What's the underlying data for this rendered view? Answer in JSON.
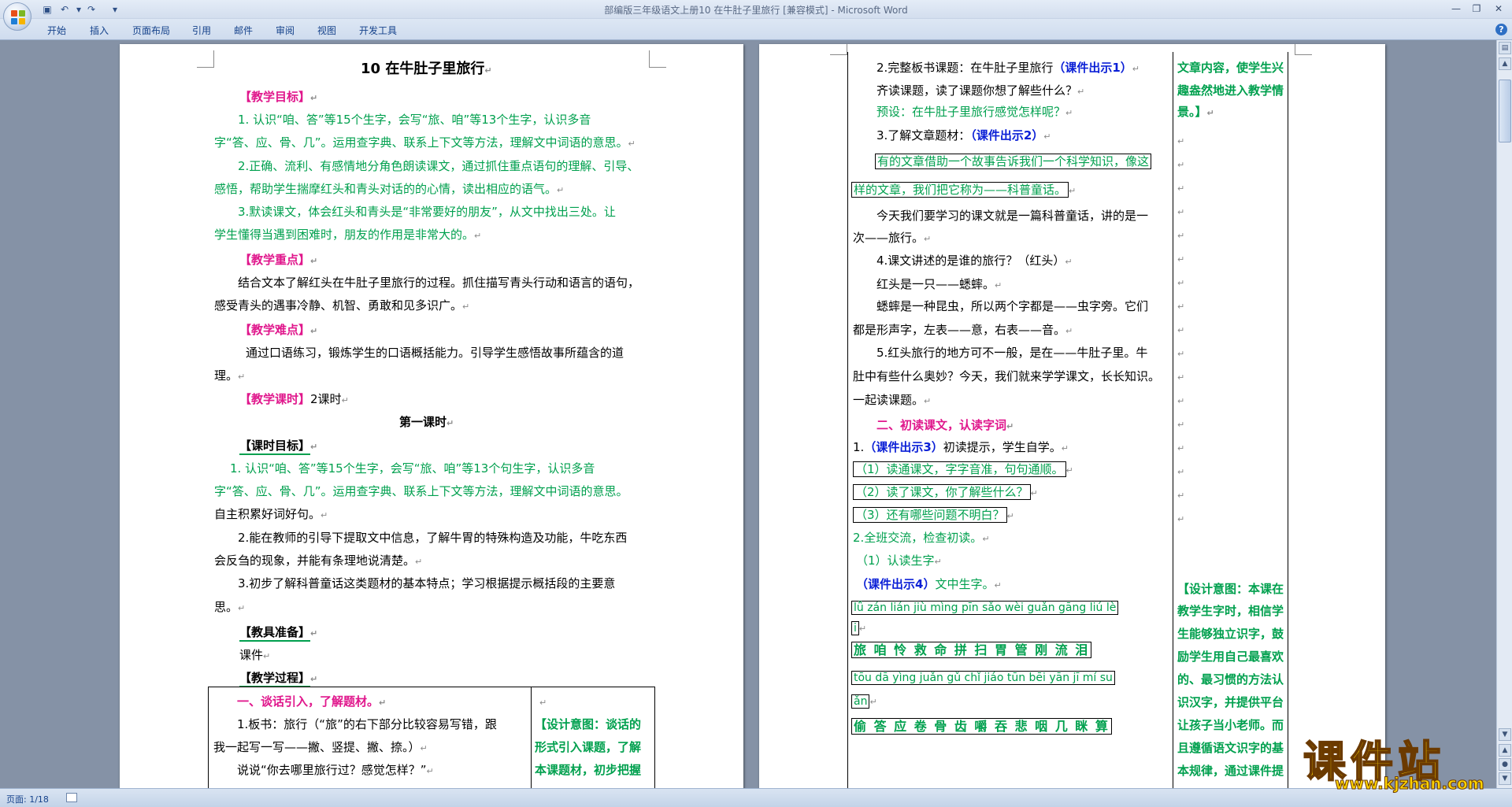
{
  "window": {
    "title": "部编版三年级语文上册10 在牛肚子里旅行 [兼容模式] - Microsoft Word"
  },
  "ribbon": {
    "tabs": [
      "开始",
      "插入",
      "页面布局",
      "引用",
      "邮件",
      "审阅",
      "视图",
      "开发工具"
    ]
  },
  "page1": {
    "title": "10  在牛肚子里旅行",
    "lines": [
      [
        "【教学目标】"
      ],
      [
        "1. 认识“咱、答”等15个生字，会写“旅、咱”等13个生字，认识多音"
      ],
      [
        "字“答、应、骨、几”。运用查字典、联系上下文等方法，理解文中词语的意思。"
      ],
      [
        "2.正确、流利、有感情地分角色朗读课文，通过抓住重点语句的理解、引导、"
      ],
      [
        "感悟，帮助学生揣摩红头和青头对话的的心情，读出相应的语气。"
      ],
      [
        "3.默读课文，体会红头和青头是“非常要好的朋友”，从文中找出三处。让"
      ],
      [
        "学生懂得当遇到困难时，朋友的作用是非常大的。"
      ],
      [
        "【教学重点】"
      ],
      [
        "结合文本了解红头在牛肚子里旅行的过程。抓住描写青头行动和语言的语句，"
      ],
      [
        "感受青头的遇事冷静、机智、勇敢和见多识广。"
      ],
      [
        "【教学难点】"
      ],
      [
        "通过口语练习，锻炼学生的口语概括能力。引导学生感悟故事所蕴含的道"
      ],
      [
        "理。"
      ],
      [
        "【教学课时】",
        "2课时"
      ],
      [
        "第一课时"
      ],
      [
        "【课时目标】"
      ],
      [
        "1. 认识“咱、答”等15个生字，会写“旅、咱”等13个句生字，认识多音"
      ],
      [
        "字“答、应、骨、几”。运用查字典、联系上下文等方法，理解文中词语的意思。"
      ],
      [
        "自主积累好词好句。"
      ],
      [
        "2.能在教师的引导下提取文中信息，了解牛胃的特殊构造及功能，牛吃东西"
      ],
      [
        "会反刍的现象，并能有条理地说清楚。"
      ],
      [
        "3.初步了解科普童话这类题材的基本特点；学习根据提示概括段的主要意"
      ],
      [
        "思。"
      ],
      [
        "【教具准备】"
      ],
      [
        "课件"
      ],
      [
        "【教学过程】"
      ]
    ],
    "table": {
      "left": [
        "一、谈话引入，了解题材。",
        "1.板书：旅行（“旅”的右下部分比较容易写错，跟",
        "我一起写一写——撇、竖提、撇、捺。）",
        "说说“你去哪里旅行过？感觉怎样？”"
      ],
      "right": [
        "【设计意图：谈话的",
        "形式引入课题，了解",
        "本课题材，初步把握"
      ]
    }
  },
  "page2": {
    "left": [
      [
        "2.完整板书课题：在牛肚子里旅行",
        "（课件出示1）"
      ],
      [
        "齐读课题，读了课题你想了解些什么？"
      ],
      [
        "预设：在牛肚子里旅行感觉怎样呢？"
      ],
      [
        "3.了解文章题材：",
        "（课件出示2）"
      ],
      [
        "有的文章借助一个故事告诉我们一个科学知识，像这"
      ],
      [
        "样的文章，我们把它称为——科普童话。"
      ],
      [
        "今天我们要学习的课文就是一篇科普童话，讲的是一"
      ],
      [
        "次——旅行。"
      ],
      [
        "4.课文讲述的是谁的旅行？（红头）"
      ],
      [
        "红头是一只——蟋蟀。"
      ],
      [
        "蟋蟀是一种昆虫，所以两个字都是——虫字旁。它们"
      ],
      [
        "都是形声字，左表——意，右表——音。"
      ],
      [
        "5.红头旅行的地方可不一般，是在——牛肚子里。牛"
      ],
      [
        "肚中有些什么奥妙？今天，我们就来学学课文，长长知识。"
      ],
      [
        "一起读课题。"
      ],
      [
        "二、初读课文，认读字词"
      ],
      [
        "1.",
        "（课件出示3）",
        "初读提示，学生自学。"
      ],
      [
        "（1）读通课文，字字音准，句句通顺。"
      ],
      [
        "（2）读了课文，你了解些什么？"
      ],
      [
        "（3）还有哪些问题不明白？"
      ],
      [
        "2.全班交流，检查初读。"
      ],
      [
        "（1）认读生字"
      ],
      [
        "（课件出示4）",
        "文中生字。"
      ],
      [
        "lǚ zán lián jiù mìng pīn sǎo wèi guǎn gāng liú lè"
      ],
      [
        "i"
      ],
      [
        "旅 咱 怜 救 命 拼 扫 胃 管 刚 流 泪"
      ],
      [
        "tōu dā yìng juǎn gǔ chǐ jiáo tūn bēi yān jī  mí su"
      ],
      [
        "ǎn"
      ],
      [
        "偷 答 应 卷 骨 齿 嚼 吞 悲 咽 几 眯 算"
      ]
    ],
    "right": [
      "文章内容，使学生兴",
      "趣盎然地进入教学情",
      "景。】",
      "【设计意图：本课在",
      "教学生字时，相信学",
      "生能够独立识字，鼓",
      "励学生用自己最喜欢",
      "的、最习惯的方法认",
      "识汉字，并提供平台",
      "让孩子当小老师。而",
      "且遵循语文识字的基",
      "本规律，通过课件提"
    ]
  },
  "status": {
    "page": "页面: 1/18"
  },
  "watermark": {
    "text": "课件站",
    "url": "www.kjzhan.com"
  },
  "colors": {
    "green": "#00a04e",
    "magenta": "#e0178c",
    "blue": "#0a1fd6"
  }
}
